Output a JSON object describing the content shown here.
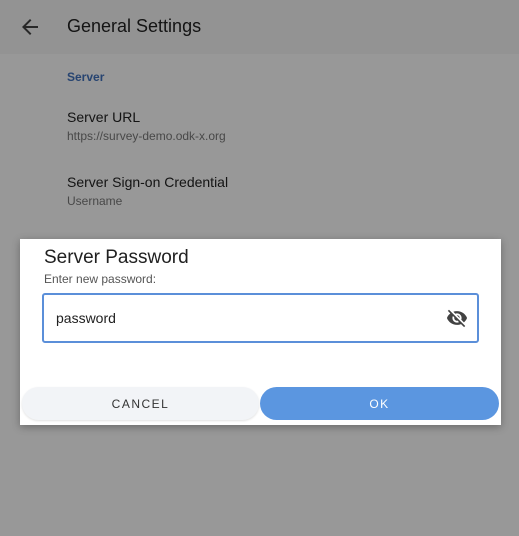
{
  "app_bar": {
    "title": "General Settings",
    "back_icon": "arrow-left-icon"
  },
  "settings": {
    "section_header": "Server",
    "items": [
      {
        "title": "Server URL",
        "summary": "https://survey-demo.odk-x.org"
      },
      {
        "title": "Server Sign-on Credential",
        "summary": "Username"
      }
    ]
  },
  "dialog": {
    "title": "Server Password",
    "message": "Enter new password:",
    "password_value": "password",
    "visibility_icon": "eye-off-icon",
    "cancel_label": "CANCEL",
    "ok_label": "OK"
  },
  "colors": {
    "accent": "#5b96e0",
    "focus_border": "#5b8fd9",
    "section_header": "#3f6fb6"
  }
}
